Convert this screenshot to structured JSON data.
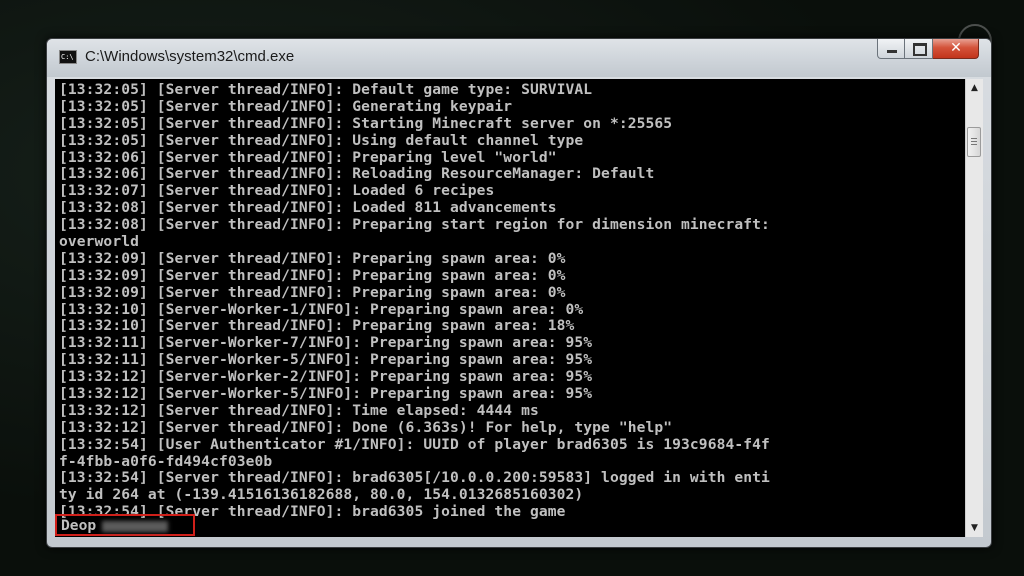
{
  "window": {
    "title": "C:\\Windows\\system32\\cmd.exe",
    "icon_label": "C:\\",
    "minimize_icon": "minimize-icon",
    "maximize_icon": "maximize-icon",
    "close_icon": "close-icon"
  },
  "console": {
    "lines": [
      "[13:32:05] [Server thread/INFO]: Default game type: SURVIVAL",
      "[13:32:05] [Server thread/INFO]: Generating keypair",
      "[13:32:05] [Server thread/INFO]: Starting Minecraft server on *:25565",
      "[13:32:05] [Server thread/INFO]: Using default channel type",
      "[13:32:06] [Server thread/INFO]: Preparing level \"world\"",
      "[13:32:06] [Server thread/INFO]: Reloading ResourceManager: Default",
      "[13:32:07] [Server thread/INFO]: Loaded 6 recipes",
      "[13:32:08] [Server thread/INFO]: Loaded 811 advancements",
      "[13:32:08] [Server thread/INFO]: Preparing start region for dimension minecraft:",
      "overworld",
      "[13:32:09] [Server thread/INFO]: Preparing spawn area: 0%",
      "[13:32:09] [Server thread/INFO]: Preparing spawn area: 0%",
      "[13:32:09] [Server thread/INFO]: Preparing spawn area: 0%",
      "[13:32:10] [Server-Worker-1/INFO]: Preparing spawn area: 0%",
      "[13:32:10] [Server thread/INFO]: Preparing spawn area: 18%",
      "[13:32:11] [Server-Worker-7/INFO]: Preparing spawn area: 95%",
      "[13:32:11] [Server-Worker-5/INFO]: Preparing spawn area: 95%",
      "[13:32:12] [Server-Worker-2/INFO]: Preparing spawn area: 95%",
      "[13:32:12] [Server-Worker-5/INFO]: Preparing spawn area: 95%",
      "[13:32:12] [Server thread/INFO]: Time elapsed: 4444 ms",
      "[13:32:12] [Server thread/INFO]: Done (6.363s)! For help, type \"help\"",
      "[13:32:54] [User Authenticator #1/INFO]: UUID of player brad6305 is 193c9684-f4f",
      "f-4fbb-a0f6-fd494cf03e0b",
      "[13:32:54] [Server thread/INFO]: brad6305[/10.0.0.200:59583] logged in with enti",
      "ty id 264 at (-139.41516136182688, 80.0, 154.0132685160302)",
      "[13:32:54] [Server thread/INFO]: brad6305 joined the game"
    ],
    "input_command": "Deop"
  },
  "scrollbar": {
    "up_arrow": "▲",
    "down_arrow": "▼"
  }
}
